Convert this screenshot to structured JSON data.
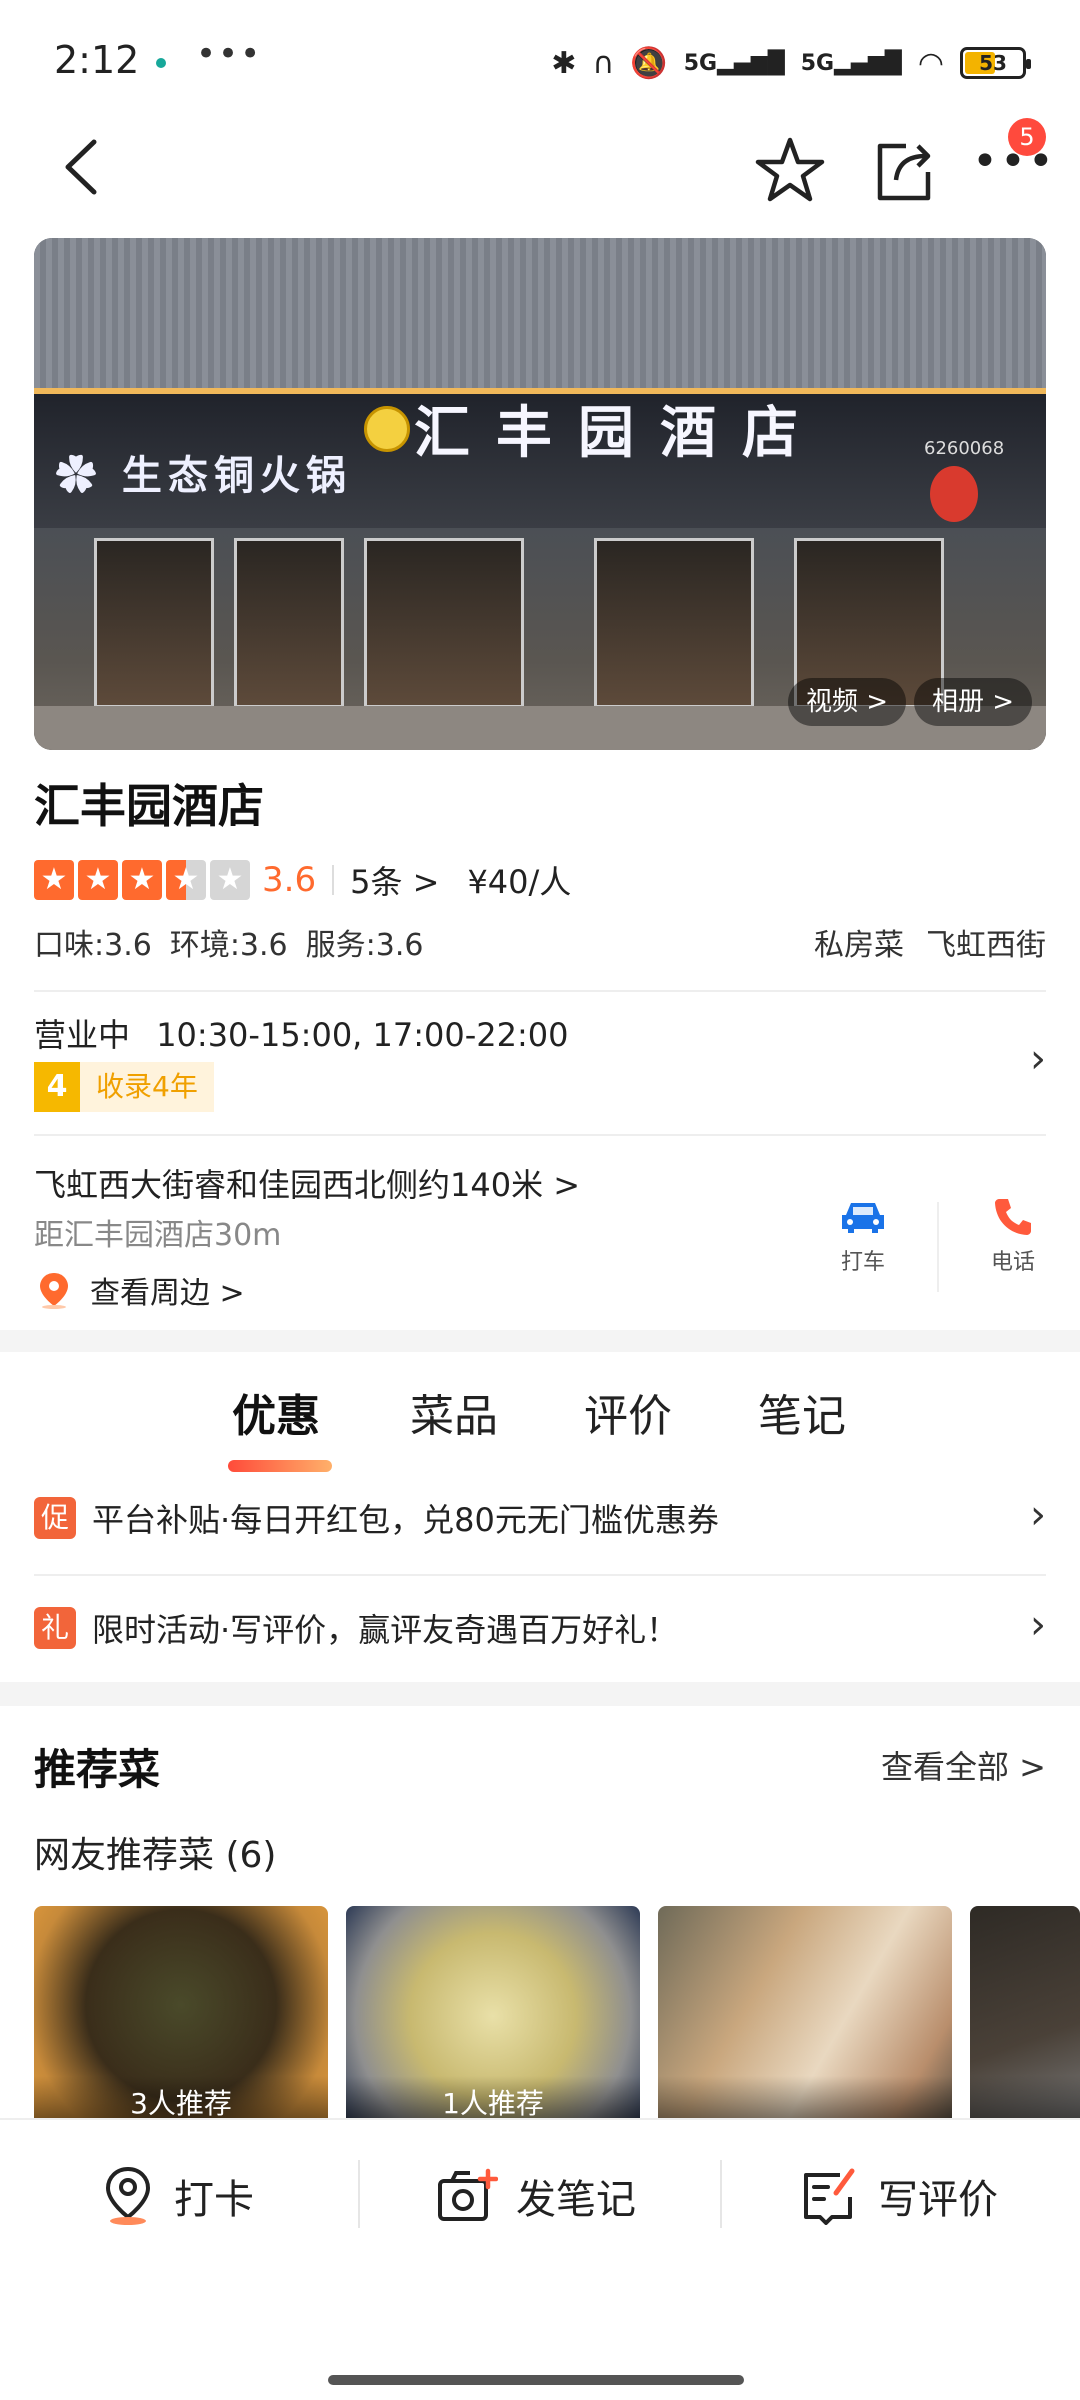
{
  "status_bar": {
    "time": "2:12",
    "dots": "•••",
    "signal_1": "5G",
    "signal_2": "5G",
    "battery": "53"
  },
  "header": {
    "notification_count": "5",
    "icons": [
      "back-arrow-icon",
      "star-outline-icon",
      "share-icon",
      "more-icon"
    ]
  },
  "hero": {
    "video_label": "视频 >",
    "album_label": "相册 >"
  },
  "restaurant": {
    "name": "汇丰园酒店",
    "rating": "3.6",
    "stars": 3.5,
    "review_count": "5条 >",
    "price": "¥40/人",
    "taste": "口味:3.6",
    "environment": "环境:3.6",
    "service": "服务:3.6",
    "category": "私房菜",
    "area": "飞虹西街",
    "status": "营业中",
    "hours": "10:30-15:00, 17:00-22:00",
    "years_num": "4",
    "years_text": "收录4年",
    "address": "飞虹西大街睿和佳园西北侧约140米 >",
    "distance": "距汇丰园酒店30m",
    "nearby": "查看周边 >",
    "taxi_label": "打车",
    "phone_label": "电话"
  },
  "tabs": {
    "items": [
      "优惠",
      "菜品",
      "评价",
      "笔记"
    ],
    "active": "优惠"
  },
  "promotions": [
    {
      "tag": "促",
      "text": "平台补贴·每日开红包，兑80元无门槛优惠券"
    },
    {
      "tag": "礼",
      "text": "限时活动·写评价，赢评友奇遇百万好礼！"
    }
  ],
  "dishes": {
    "title": "推荐菜",
    "view_all": "查看全部 >",
    "subtitle": "网友推荐菜 (6)",
    "items": [
      {
        "label": "3人推荐"
      },
      {
        "label": "1人推荐"
      },
      {
        "label": ""
      },
      {
        "label": ""
      }
    ]
  },
  "bottom_bar": {
    "checkin": "打卡",
    "post_note": "发笔记",
    "write_review": "写评价"
  },
  "colors": {
    "accent": "#ff6a2e",
    "badge": "#ff4a3d",
    "years_badge": "#f6b800",
    "taxi": "#1a73e8",
    "phone": "#ff5a3c"
  }
}
